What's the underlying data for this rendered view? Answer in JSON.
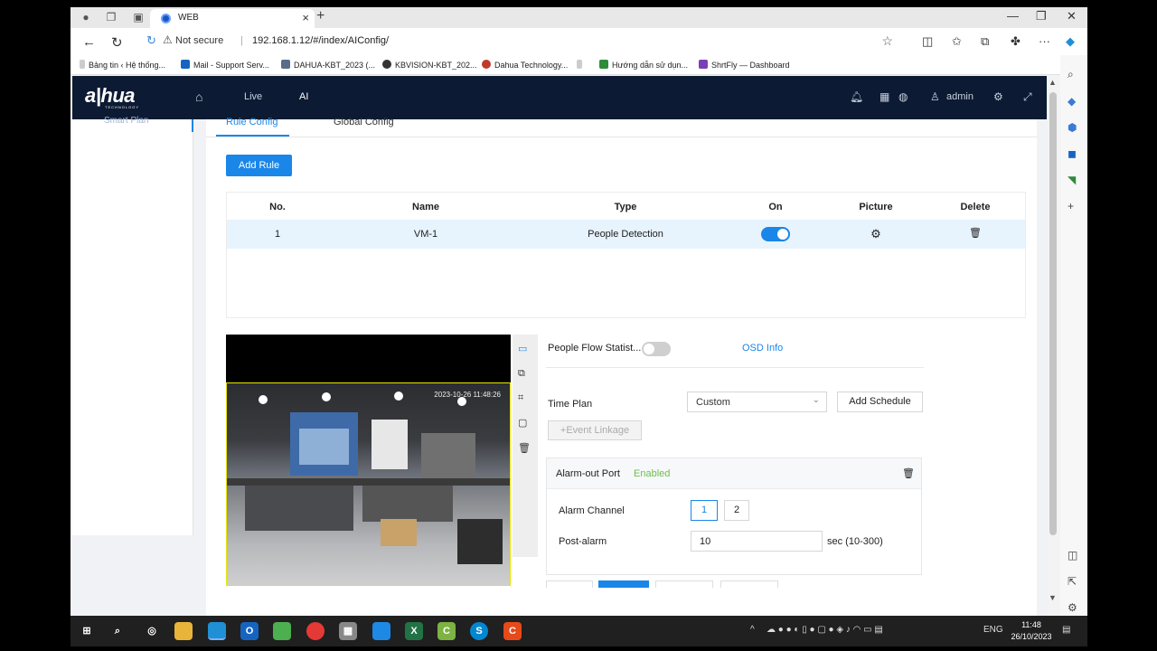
{
  "browser": {
    "tab_title": "WEB",
    "security_label": "Not secure",
    "url": "192.168.1.12/#/index/AIConfig/",
    "bookmarks": [
      "Bảng tin ‹ Hệ thống...",
      "Mail - Support Serv...",
      "DAHUA-KBT_2023 (...",
      "KBVISION-KBT_202...",
      "Dahua Technology...",
      "Hướng dẫn sử dụn...",
      "ShrtFly — Dashboard"
    ]
  },
  "app": {
    "logo": "a|hua",
    "logo_sub": "TECHNOLOGY",
    "nav": {
      "live": "Live",
      "ai": "AI"
    },
    "user": "admin",
    "sidebar_item": "Smart Plan"
  },
  "tabs": {
    "rule_config": "Rule Config",
    "global_config": "Global Config"
  },
  "add_rule": "Add Rule",
  "table": {
    "headers": [
      "No.",
      "Name",
      "Type",
      "On",
      "Picture",
      "Delete"
    ],
    "rows": [
      {
        "no": "1",
        "name": "VM-1",
        "type": "People Detection",
        "on": true
      }
    ]
  },
  "video": {
    "timestamp": "2023-10-26 11:48:26"
  },
  "form": {
    "people_flow_label": "People Flow Statist...",
    "people_flow_on": false,
    "osd_info": "OSD Info",
    "time_plan_label": "Time Plan",
    "time_plan_value": "Custom",
    "add_schedule": "Add Schedule",
    "event_linkage": "+Event Linkage",
    "alarm_out_label": "Alarm-out Port",
    "alarm_out_status": "Enabled",
    "alarm_channel_label": "Alarm Channel",
    "channels": [
      "1",
      "2"
    ],
    "post_alarm_label": "Post-alarm",
    "post_alarm_value": "10",
    "post_alarm_unit": "sec (10-300)"
  },
  "taskbar": {
    "lang": "ENG",
    "time": "11:48",
    "date": "26/10/2023"
  },
  "colors": {
    "accent": "#1a86e8",
    "header": "#0c1a33",
    "enabled": "#6cc04a"
  }
}
